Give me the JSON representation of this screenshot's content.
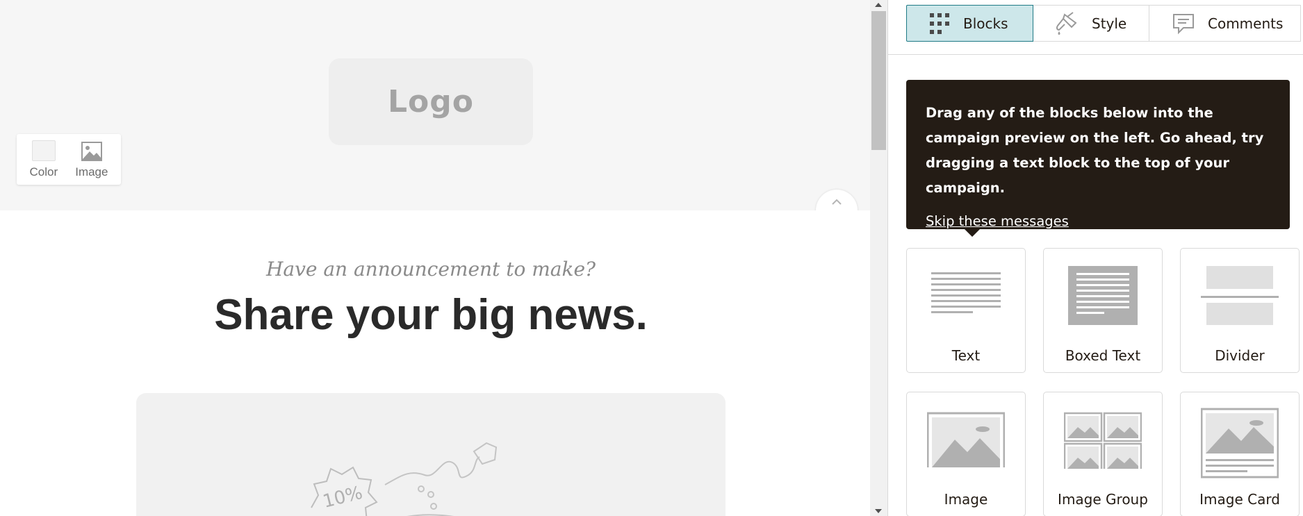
{
  "preview": {
    "logo_text": "Logo",
    "toolbar": {
      "color_label": "Color",
      "image_label": "Image"
    },
    "kicker": "Have an announcement to make?",
    "headline": "Share your big news.",
    "hero_badge": "10%"
  },
  "panel": {
    "tabs": [
      {
        "label": "Blocks",
        "icon": "grid-icon",
        "active": true
      },
      {
        "label": "Style",
        "icon": "paint-brush-icon",
        "active": false
      },
      {
        "label": "Comments",
        "icon": "comment-icon",
        "active": false
      }
    ],
    "tooltip": {
      "text": "Drag any of the blocks below into the campaign preview on the left. Go ahead, try dragging a text block to the top of your campaign.",
      "link": "Skip these messages"
    },
    "blocks": [
      {
        "label": "Text",
        "icon": "text-block-icon"
      },
      {
        "label": "Boxed Text",
        "icon": "boxed-text-block-icon"
      },
      {
        "label": "Divider",
        "icon": "divider-block-icon"
      },
      {
        "label": "Image",
        "icon": "image-block-icon"
      },
      {
        "label": "Image Group",
        "icon": "image-group-block-icon"
      },
      {
        "label": "Image Card",
        "icon": "image-card-block-icon"
      }
    ]
  },
  "colors": {
    "tooltip_bg": "#241c15",
    "active_tab_bg": "#cde7ea",
    "active_tab_border": "#1f7a86"
  }
}
